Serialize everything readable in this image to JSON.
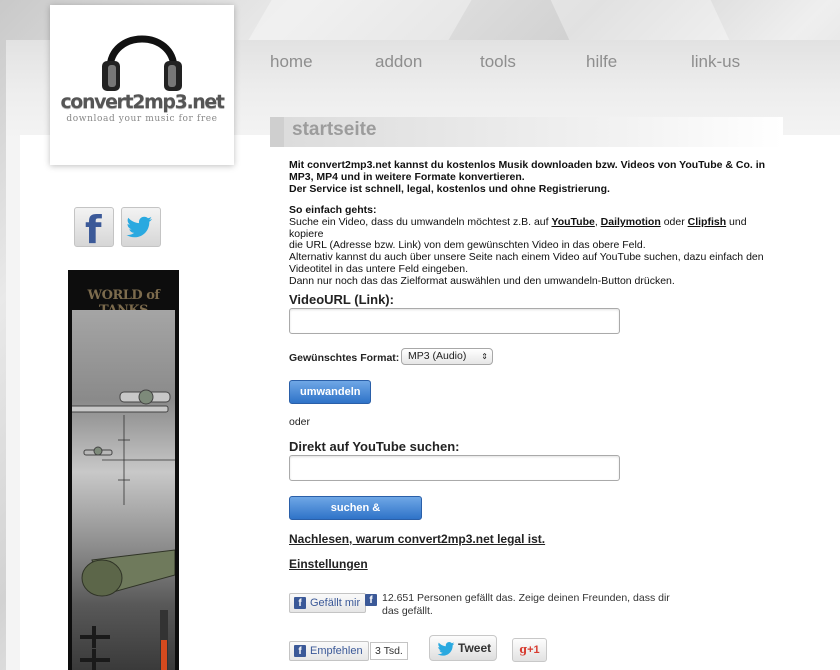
{
  "site": {
    "logo_title": "convert2mp3.net",
    "logo_slogan": "download your music for free"
  },
  "nav": {
    "items": [
      {
        "label": "home"
      },
      {
        "label": "addon"
      },
      {
        "label": "tools"
      },
      {
        "label": "hilfe"
      },
      {
        "label": "link-us"
      }
    ]
  },
  "ad": {
    "brand": "WORLD of TANKS"
  },
  "main": {
    "section_title": "startseite",
    "intro_line1": "Mit convert2mp3.net kannst du kostenlos Musik downloaden bzw. Videos von YouTube & Co. in",
    "intro_line2": "MP3, MP4 und in weitere Formate konvertieren.",
    "intro_line3": "Der Service ist schnell, legal, kostenlos und ohne Registrierung.",
    "how_title": "So einfach gehts:",
    "how_text_1": "Suche ein Video, dass du umwandeln möchtest z.B. auf",
    "how_link_youtube": "YouTube",
    "how_sep_comma": ",",
    "how_link_dailymotion": "Dailymotion",
    "how_oder": "oder",
    "how_link_clipfish": "Clipfish",
    "how_text_2": "und kopiere",
    "how_line2": "die URL (Adresse bzw. Link) von dem gewünschten Video in das obere Feld.",
    "how_line3": "Alternativ kannst du auch über unsere Seite nach einem Video auf YouTube suchen, dazu einfach den",
    "how_line4": "Videotitel in das untere Feld eingeben.",
    "how_line5": "Dann nur noch das das Zielformat auswählen und den umwandeln-Button drücken.",
    "video_url_label": "VideoURL (Link):",
    "video_url_value": "",
    "format_label": "Gewünschtes Format:",
    "format_selected": "MP3 (Audio)",
    "convert_button": "umwandeln",
    "or_text": "oder",
    "search_label": "Direkt auf YouTube suchen:",
    "search_value": "",
    "search_button": "suchen & umwandeln",
    "legal_link": "Nachlesen, warum convert2mp3.net legal ist.",
    "settings_link": "Einstellungen"
  },
  "social": {
    "fb_like_button": "Gefällt mir",
    "fb_like_text": "12.651 Personen gefällt das. Zeige deinen Freunden, dass dir das gefällt.",
    "fb_recommend_button": "Empfehlen",
    "fb_recommend_count": "3 Tsd.",
    "tweet_button": "Tweet",
    "gplus_button": "+1"
  },
  "colors": {
    "button_blue": "#2f73c8",
    "facebook_blue": "#3b5998",
    "twitter_blue": "#2aa9e0",
    "nav_gray": "#8e8e8e"
  }
}
